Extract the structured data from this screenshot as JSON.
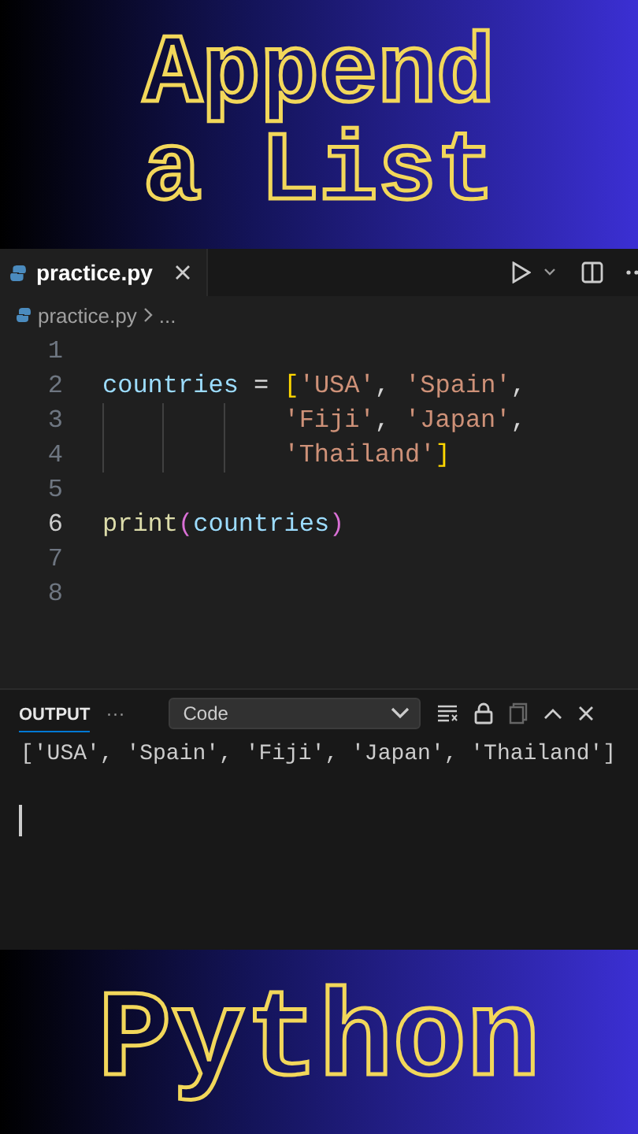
{
  "top_banner": {
    "lines": [
      "Append",
      "a List"
    ]
  },
  "editor": {
    "tab": {
      "label": "practice.py",
      "selected": true
    },
    "breadcrumb": {
      "file": "practice.py",
      "rest": "..."
    },
    "lines": [
      {
        "number": "1",
        "active": false
      },
      {
        "number": "2",
        "active": false,
        "continuation": false,
        "tokens": [
          {
            "kind": "var",
            "text": "countries"
          },
          {
            "kind": "op",
            "text": " = "
          },
          {
            "kind": "bracket",
            "text": "["
          },
          {
            "kind": "str",
            "text": "'USA'"
          },
          {
            "kind": "op",
            "text": ", "
          },
          {
            "kind": "str",
            "text": "'Spain'"
          },
          {
            "kind": "op",
            "text": ","
          }
        ]
      },
      {
        "number": "3",
        "active": false,
        "continuation": true,
        "tokens": [
          {
            "kind": "str",
            "text": "'Fiji'"
          },
          {
            "kind": "op",
            "text": ", "
          },
          {
            "kind": "str",
            "text": "'Japan'"
          },
          {
            "kind": "op",
            "text": ","
          }
        ]
      },
      {
        "number": "4",
        "active": false,
        "continuation": true,
        "tokens": [
          {
            "kind": "str",
            "text": "'Thailand'"
          },
          {
            "kind": "bracket",
            "text": "]"
          }
        ]
      },
      {
        "number": "5",
        "active": false
      },
      {
        "number": "6",
        "active": true,
        "continuation": false,
        "tokens": [
          {
            "kind": "func",
            "text": "print"
          },
          {
            "kind": "paren",
            "text": "("
          },
          {
            "kind": "var",
            "text": "countries"
          },
          {
            "kind": "paren",
            "text": ")"
          }
        ]
      },
      {
        "number": "7",
        "active": false
      },
      {
        "number": "8",
        "active": false
      }
    ]
  },
  "panel": {
    "tabs": [
      {
        "label": "OUTPUT",
        "selected": true
      }
    ],
    "more": "···",
    "channel": "Code",
    "output": [
      "['USA', 'Spain', 'Fiji', 'Japan', 'Thailand']"
    ]
  },
  "bottom_banner": {
    "lines": [
      "Python"
    ]
  }
}
